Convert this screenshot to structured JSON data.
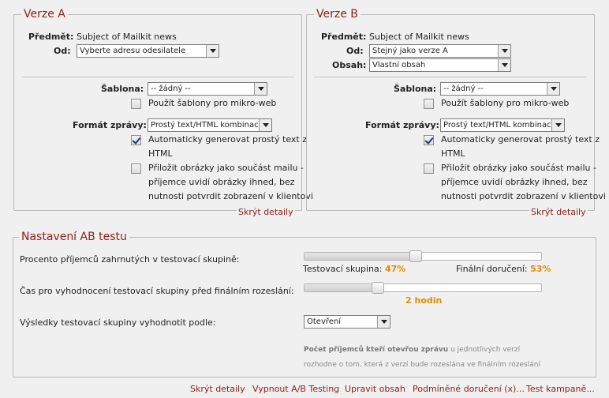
{
  "verze_a": {
    "legend": "Verze A",
    "subject_label": "Předmět:",
    "subject_value": "Subject of Mailkit news",
    "from_label": "Od:",
    "from_value": "Vyberte adresu odesilatele",
    "template_label": "Šablona:",
    "template_value": "-- žádný --",
    "microweb_label": "Použít šablony pro mikro-web",
    "microweb_checked": false,
    "format_label": "Formát zprávy:",
    "format_value": "Prostý text/HTML kombinace",
    "auto_text_line1": "Automaticky generovat prostý text z",
    "auto_text_line2": "HTML",
    "auto_text_checked": true,
    "attach_line1": "Přiložit obrázky jako součást mailu -",
    "attach_line2": "příjemce uvidí obrázky ihned, bez",
    "attach_line3": "nutnosti potvrdit zobrazení v klientovi",
    "attach_checked": false,
    "hide_link": "Skrýt detaily"
  },
  "verze_b": {
    "legend": "Verze B",
    "subject_label": "Předmět:",
    "subject_value": "Subject of Mailkit news",
    "from_label": "Od:",
    "from_value": "Stejný jako verze A",
    "content_label": "Obsah:",
    "content_value": "Vlastní obsah",
    "template_label": "Šablona:",
    "template_value": "-- žádný --",
    "microweb_label": "Použít šablony pro mikro-web",
    "microweb_checked": false,
    "format_label": "Formát zprávy:",
    "format_value": "Prostý text/HTML kombinace",
    "auto_text_line1": "Automaticky generovat prostý text z",
    "auto_text_line2": "HTML",
    "auto_text_checked": true,
    "attach_line1": "Přiložit obrázky jako součást mailu -",
    "attach_line2": "příjemce uvidí obrázky ihned, bez",
    "attach_line3": "nutnosti potvrdit zobrazení v klientovi",
    "attach_checked": false,
    "hide_link": "Skrýt detaily"
  },
  "ab_test": {
    "legend": "Nastavení AB testu",
    "percent_label": "Procento příjemců zahrnutých v testovací skupině:",
    "test_group_label": "Testovací skupina:",
    "test_group_value": "47%",
    "final_label": "Finální doručení:",
    "final_value": "53%",
    "percent_fraction": 0.47,
    "time_label": "Čas pro vyhodnocení testovací skupiny před finálním rozeslání:",
    "time_value": "2 hodin",
    "time_fraction": 0.31,
    "evaluate_label": "Výsledky testovací skupiny vyhodnotit podle:",
    "evaluate_value": "Otevření",
    "hint_bold": "Počet příjemců kteří otevřou zprávu",
    "hint_rest1": " u jednotlivých verzí",
    "hint_line2": "rozhodne o tom, která z verzí bude rozeslána ve finálním rozeslání"
  },
  "footer": {
    "hide_details": "Skrýt detaily",
    "disable_ab": "Vypnout A/B Testing",
    "edit_content": "Upravit obsah",
    "conditional": "Podmíněné doručení (x)...",
    "test_campaign": "Test kampaně..."
  },
  "colors": {
    "accent": "#8b1f16",
    "highlight": "#e58b00"
  }
}
